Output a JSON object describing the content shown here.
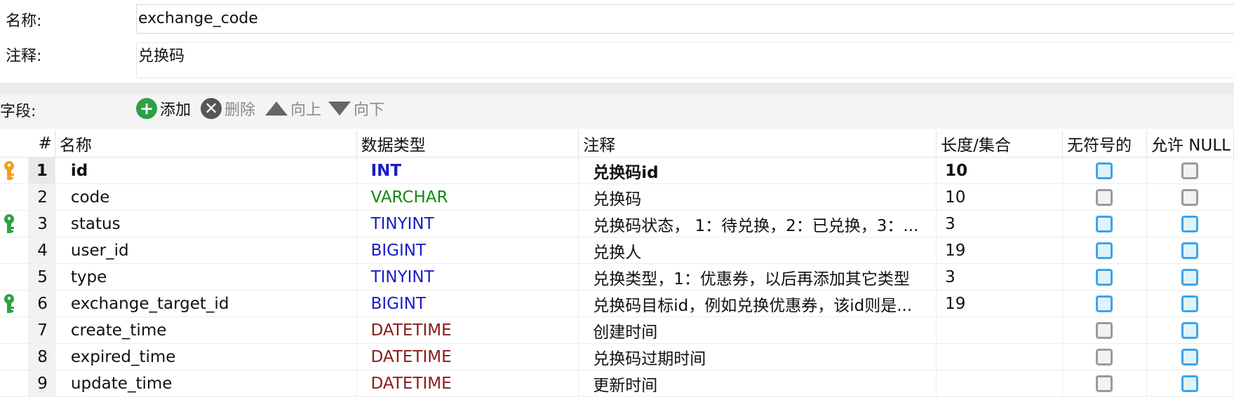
{
  "form": {
    "name_label": "名称:",
    "name_value": "exchange_code",
    "comment_label": "注释:",
    "comment_value": "兑换码"
  },
  "toolbar": {
    "fields_label": "字段:",
    "add_label": "添加",
    "delete_label": "删除",
    "up_label": "向上",
    "down_label": "向下"
  },
  "columns": [
    "#",
    "名称",
    "数据类型",
    "注释",
    "长度/集合",
    "无符号的",
    "允许 NULL"
  ],
  "rows": [
    {
      "num": "1",
      "name": "id",
      "type": "INT",
      "type_class": "t-int",
      "comment": "兑换码id",
      "length": "10",
      "unsigned": true,
      "nullable": false,
      "key": "primary",
      "selected": true
    },
    {
      "num": "2",
      "name": "code",
      "type": "VARCHAR",
      "type_class": "t-varchar",
      "comment": "兑换码",
      "length": "10",
      "unsigned": false,
      "nullable": false,
      "key": "",
      "selected": false
    },
    {
      "num": "3",
      "name": "status",
      "type": "TINYINT",
      "type_class": "t-int",
      "comment": "兑换码状态， 1：待兑换，2：已兑换，3：...",
      "length": "3",
      "unsigned": true,
      "nullable": true,
      "key": "index",
      "selected": false
    },
    {
      "num": "4",
      "name": "user_id",
      "type": "BIGINT",
      "type_class": "t-int",
      "comment": "兑换人",
      "length": "19",
      "unsigned": true,
      "nullable": true,
      "key": "",
      "selected": false
    },
    {
      "num": "5",
      "name": "type",
      "type": "TINYINT",
      "type_class": "t-int",
      "comment": "兑换类型，1：优惠券，以后再添加其它类型",
      "length": "3",
      "unsigned": true,
      "nullable": true,
      "key": "",
      "selected": false
    },
    {
      "num": "6",
      "name": "exchange_target_id",
      "type": "BIGINT",
      "type_class": "t-int",
      "comment": "兑换码目标id，例如兑换优惠券，该id则是...",
      "length": "19",
      "unsigned": true,
      "nullable": true,
      "key": "index",
      "selected": false
    },
    {
      "num": "7",
      "name": "create_time",
      "type": "DATETIME",
      "type_class": "t-datetime",
      "comment": "创建时间",
      "length": "",
      "unsigned": false,
      "nullable": true,
      "key": "",
      "selected": false
    },
    {
      "num": "8",
      "name": "expired_time",
      "type": "DATETIME",
      "type_class": "t-datetime",
      "comment": "兑换码过期时间",
      "length": "",
      "unsigned": false,
      "nullable": true,
      "key": "",
      "selected": false
    },
    {
      "num": "9",
      "name": "update_time",
      "type": "DATETIME",
      "type_class": "t-datetime",
      "comment": "更新时间",
      "length": "",
      "unsigned": false,
      "nullable": true,
      "key": "",
      "selected": false
    }
  ],
  "colors": {
    "primary_key": "#f0a020",
    "index_key": "#2ea043",
    "checkbox_on": "#3da3ea",
    "checkbox_off": "#9a9a9a"
  },
  "icons": {
    "add": "plus-circle-icon",
    "delete": "x-circle-icon",
    "up": "triangle-up-icon",
    "down": "triangle-down-icon",
    "primary_key": "key-icon",
    "index_key": "key-icon"
  }
}
